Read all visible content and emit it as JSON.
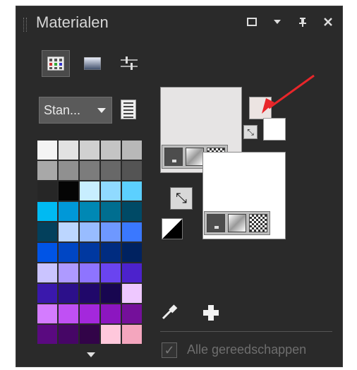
{
  "panel": {
    "title": "Materialen",
    "title_buttons": [
      "maximize-icon",
      "chevron-down-icon",
      "pin-icon",
      "close-icon"
    ]
  },
  "tabs": [
    {
      "name": "swatches-tab",
      "icon": "grid-icon",
      "active": true
    },
    {
      "name": "gradient-tab",
      "icon": "gradient-icon",
      "active": false
    },
    {
      "name": "adjust-tab",
      "icon": "sliders-icon",
      "active": false
    }
  ],
  "palette_dropdown": {
    "value": "Stan..."
  },
  "swatch_colors": [
    "#f4f4f4",
    "#e2e2e2",
    "#d0d0d0",
    "#c4c4c4",
    "#b8b8b8",
    "#a8a8a8",
    "#909090",
    "#7c7c7c",
    "#686868",
    "#545454",
    "#262626",
    "#050505",
    "#c8eeff",
    "#90daff",
    "#5cd0ff",
    "#00baf2",
    "#0098d8",
    "#0088b4",
    "#006e90",
    "#004a66",
    "#03405c",
    "#bcd6ff",
    "#98bcff",
    "#6e98ff",
    "#3a78ff",
    "#0054e6",
    "#0046c4",
    "#0038a0",
    "#002c80",
    "#002260",
    "#cac4ff",
    "#ae9aff",
    "#8e74ff",
    "#6a44f0",
    "#4c22cc",
    "#3a18ac",
    "#2c108a",
    "#20086a",
    "#180650",
    "#eec8ff",
    "#d47cff",
    "#c050f4",
    "#a428dc",
    "#8c16c0",
    "#74109a",
    "#5a0a80",
    "#460666",
    "#320448",
    "#ffc8dc",
    "#f4a6be"
  ],
  "materials": {
    "foreground_color": "#e6e4e4",
    "background_color": "#ffffff",
    "small_foreground": "#ece4e2",
    "small_background": "#ffffff"
  },
  "checkbox": {
    "label": "Alle gereedschappen",
    "checked": true
  },
  "colors": {
    "panel_bg": "#2a2a2a",
    "arrow": "#e8262a"
  }
}
